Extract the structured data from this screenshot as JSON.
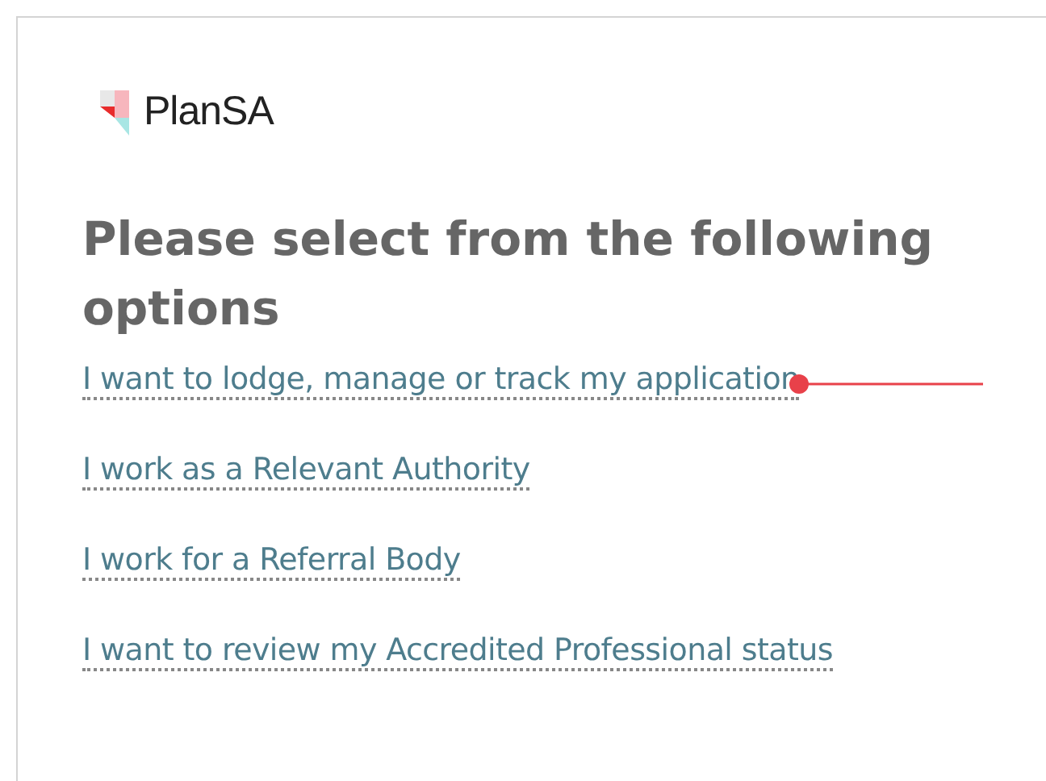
{
  "logo": {
    "text": "PlanSA"
  },
  "heading": "Please select from the following options",
  "options": [
    {
      "label": "I want to lodge, manage or track my application",
      "pointed": true
    },
    {
      "label": "I work as a Relevant Authority",
      "pointed": false
    },
    {
      "label": "I work for a Referral Body",
      "pointed": false
    },
    {
      "label": "I want to review my Accredited Professional status",
      "pointed": false
    }
  ]
}
